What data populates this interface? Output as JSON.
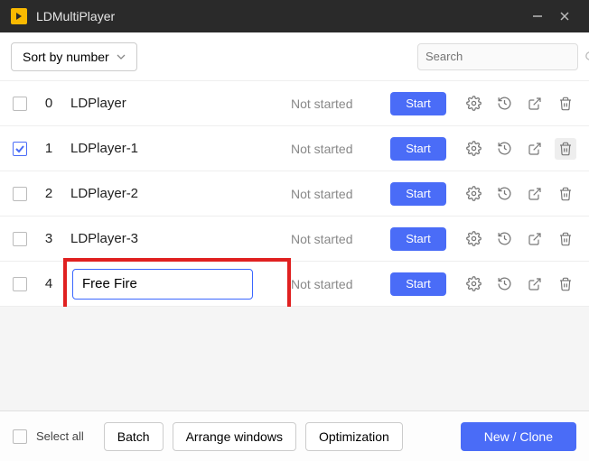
{
  "titlebar": {
    "title": "LDMultiPlayer"
  },
  "toolbar": {
    "sort_label": "Sort by number",
    "search_placeholder": "Search"
  },
  "status_label": "Not started",
  "start_label": "Start",
  "rows": [
    {
      "index": "0",
      "name": "LDPlayer",
      "checked": false,
      "editing": false
    },
    {
      "index": "1",
      "name": "LDPlayer-1",
      "checked": true,
      "editing": false,
      "deleteHover": true
    },
    {
      "index": "2",
      "name": "LDPlayer-2",
      "checked": false,
      "editing": false
    },
    {
      "index": "3",
      "name": "LDPlayer-3",
      "checked": false,
      "editing": false
    },
    {
      "index": "4",
      "name": "Free Fire",
      "checked": false,
      "editing": true
    }
  ],
  "footer": {
    "select_all": "Select all",
    "batch": "Batch",
    "arrange": "Arrange windows",
    "optimization": "Optimization",
    "new_clone": "New / Clone"
  }
}
